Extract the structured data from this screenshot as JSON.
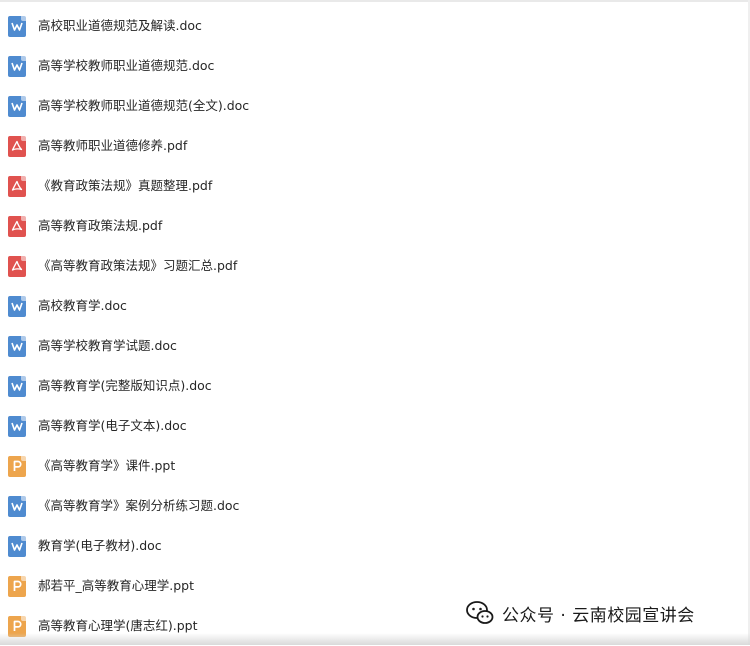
{
  "files": [
    {
      "name": "高校职业道德规范及解读.doc",
      "type": "doc",
      "icon": "word-doc-icon"
    },
    {
      "name": "高等学校教师职业道德规范.doc",
      "type": "doc",
      "icon": "word-doc-icon"
    },
    {
      "name": "高等学校教师职业道德规范(全文).doc",
      "type": "doc",
      "icon": "word-doc-icon"
    },
    {
      "name": "高等教师职业道德修养.pdf",
      "type": "pdf",
      "icon": "pdf-icon"
    },
    {
      "name": "《教育政策法规》真题整理.pdf",
      "type": "pdf",
      "icon": "pdf-icon"
    },
    {
      "name": "高等教育政策法规.pdf",
      "type": "pdf",
      "icon": "pdf-icon"
    },
    {
      "name": "《高等教育政策法规》习题汇总.pdf",
      "type": "pdf",
      "icon": "pdf-icon"
    },
    {
      "name": "高校教育学.doc",
      "type": "doc",
      "icon": "word-doc-icon"
    },
    {
      "name": "高等学校教育学试题.doc",
      "type": "doc",
      "icon": "word-doc-icon"
    },
    {
      "name": "高等教育学(完整版知识点).doc",
      "type": "doc",
      "icon": "word-doc-icon"
    },
    {
      "name": "高等教育学(电子文本).doc",
      "type": "doc",
      "icon": "word-doc-icon"
    },
    {
      "name": "《高等教育学》课件.ppt",
      "type": "ppt",
      "icon": "ppt-icon"
    },
    {
      "name": "《高等教育学》案例分析练习题.doc",
      "type": "doc",
      "icon": "word-doc-icon"
    },
    {
      "name": "教育学(电子教材).doc",
      "type": "doc",
      "icon": "word-doc-icon"
    },
    {
      "name": "郝若平_高等教育心理学.ppt",
      "type": "ppt",
      "icon": "ppt-icon"
    },
    {
      "name": "高等教育心理学(唐志红).ppt",
      "type": "ppt",
      "icon": "ppt-icon"
    }
  ],
  "watermark": {
    "text": "公众号 · 云南校园宣讲会",
    "icon": "wechat-icon"
  },
  "colors": {
    "doc": "#4f8bd0",
    "pdf": "#e0524f",
    "ppt": "#eda54d"
  }
}
